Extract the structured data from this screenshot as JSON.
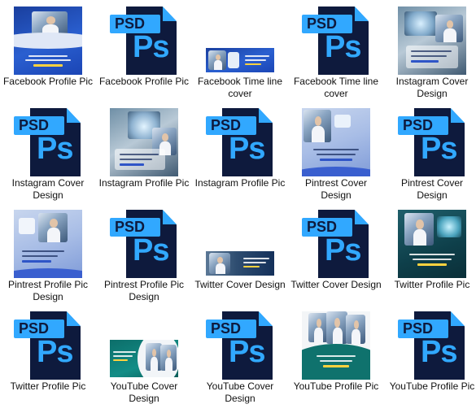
{
  "files": [
    {
      "label": "Facebook Profile Pic",
      "kind": "image",
      "thumb": "fb-profile"
    },
    {
      "label": "Facebook Profile Pic",
      "kind": "psd",
      "badge": "PSD",
      "glyph": "Ps"
    },
    {
      "label": "Facebook Time line cover",
      "kind": "image",
      "thumb": "fb-timeline"
    },
    {
      "label": "Facebook Time line cover",
      "kind": "psd",
      "badge": "PSD",
      "glyph": "Ps"
    },
    {
      "label": "Instagram Cover Design",
      "kind": "image",
      "thumb": "ig-cover"
    },
    {
      "label": "Instagram Cover Design",
      "kind": "psd",
      "badge": "PSD",
      "glyph": "Ps"
    },
    {
      "label": "Instagram Profile Pic",
      "kind": "image",
      "thumb": "ig-profile"
    },
    {
      "label": "Instagram Profile Pic",
      "kind": "psd",
      "badge": "PSD",
      "glyph": "Ps"
    },
    {
      "label": "Pintrest Cover Design",
      "kind": "image",
      "thumb": "pin-cover"
    },
    {
      "label": "Pintrest Cover Design",
      "kind": "psd",
      "badge": "PSD",
      "glyph": "Ps"
    },
    {
      "label": "Pintrest Profile Pic Design",
      "kind": "image",
      "thumb": "pin-profile"
    },
    {
      "label": "Pintrest Profile Pic Design",
      "kind": "psd",
      "badge": "PSD",
      "glyph": "Ps"
    },
    {
      "label": "Twitter Cover Design",
      "kind": "image",
      "thumb": "tw-cover"
    },
    {
      "label": "Twitter Cover Design",
      "kind": "psd",
      "badge": "PSD",
      "glyph": "Ps"
    },
    {
      "label": "Twitter Profile Pic",
      "kind": "image",
      "thumb": "tw-profile"
    },
    {
      "label": "Twitter Profile Pic",
      "kind": "psd",
      "badge": "PSD",
      "glyph": "Ps"
    },
    {
      "label": "YouTube Cover Design",
      "kind": "image",
      "thumb": "yt-cover"
    },
    {
      "label": "YouTube Cover Design",
      "kind": "psd",
      "badge": "PSD",
      "glyph": "Ps"
    },
    {
      "label": "YouTube Profile Pic",
      "kind": "image",
      "thumb": "yt-profile"
    },
    {
      "label": "YouTube Profile Pic",
      "kind": "psd",
      "badge": "PSD",
      "glyph": "Ps"
    }
  ],
  "colors": {
    "psd_blue": "#31a8ff",
    "psd_navy": "#0e1a3d",
    "brand_blue": "#1a3f9e",
    "brand_teal": "#0c6e6a"
  }
}
